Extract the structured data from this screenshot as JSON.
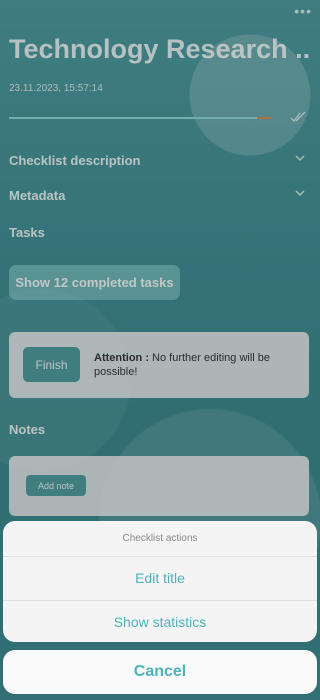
{
  "header": {
    "menu_icon": "more-dots-icon",
    "title": "Technology Research ...",
    "timestamp": "23.11.2023, 15:57:14"
  },
  "progress": {
    "value": 1.0,
    "status_icon": "double-check-icon"
  },
  "sections": {
    "description": "Checklist description",
    "metadata": "Metadata",
    "tasks": "Tasks"
  },
  "tasks": {
    "completed_button": "Show 12 completed tasks"
  },
  "finish_card": {
    "button": "Finish",
    "attention_label": "Attention :",
    "attention_text": " No further editing will be possible!"
  },
  "notes": {
    "label": "Notes",
    "add_button": "Add note"
  },
  "action_sheet": {
    "title": "Checklist actions",
    "items": [
      "Edit title",
      "Show statistics"
    ],
    "cancel": "Cancel"
  },
  "colors": {
    "accent": "#4cb3bb",
    "teal_button": "#3d8f92",
    "progress_marker": "#d4823a"
  }
}
